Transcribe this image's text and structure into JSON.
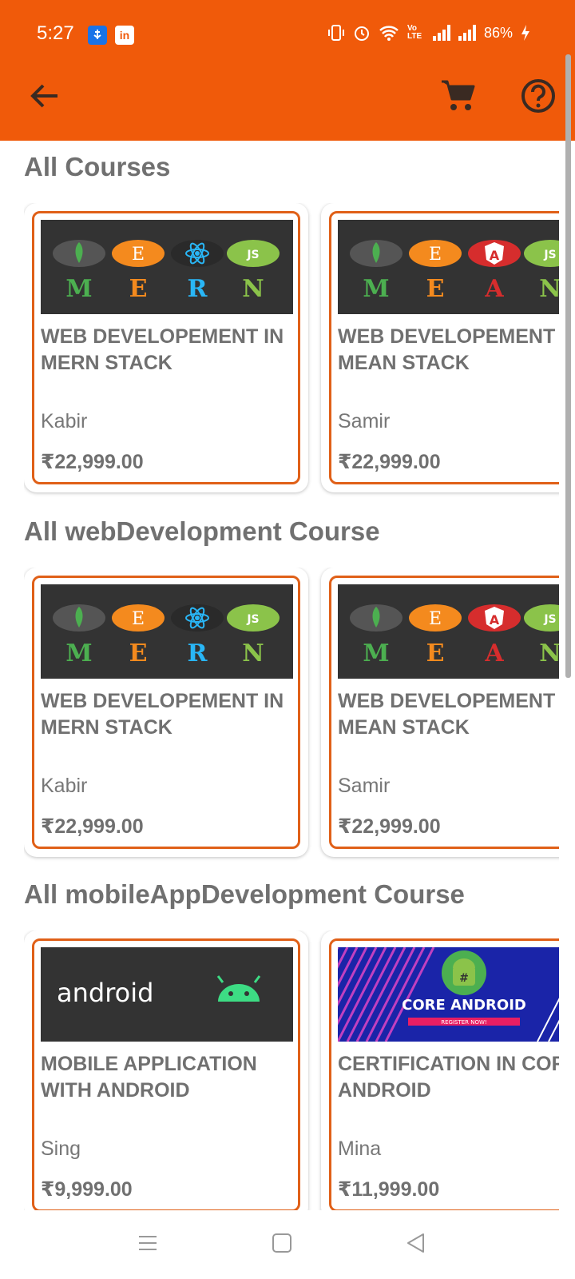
{
  "status_bar": {
    "time": "5:27",
    "battery": "86%",
    "icons": [
      "usb-icon",
      "linkedin-icon",
      "vibrate-icon",
      "alarm-icon",
      "wifi-icon",
      "volte-icon",
      "signal-icon",
      "signal-icon",
      "battery-charging-icon"
    ],
    "volte_label": "Vo LTE"
  },
  "toolbar": {
    "back_icon": "arrow-back-icon",
    "cart_icon": "cart-icon",
    "help_icon": "help-icon"
  },
  "sections": [
    {
      "title": "All Courses",
      "courses": [
        {
          "title": "WEB DEVELOPEMENT IN\nMERN STACK",
          "author": "Kabir",
          "price": "₹22,999.00",
          "thumb": "mern",
          "letters": [
            "M",
            "E",
            "R",
            "N"
          ]
        },
        {
          "title": "WEB DEVELOPEMENT IN\nMEAN STACK",
          "author": "Samir",
          "price": "₹22,999.00",
          "thumb": "mean",
          "letters": [
            "M",
            "E",
            "A",
            "N"
          ]
        }
      ]
    },
    {
      "title": "All webDevelopment Course",
      "courses": [
        {
          "title": "WEB DEVELOPEMENT IN\nMERN STACK",
          "author": "Kabir",
          "price": "₹22,999.00",
          "thumb": "mern",
          "letters": [
            "M",
            "E",
            "R",
            "N"
          ]
        },
        {
          "title": "WEB DEVELOPEMENT IN\nMEAN STACK",
          "author": "Samir",
          "price": "₹22,999.00",
          "thumb": "mean",
          "letters": [
            "M",
            "E",
            "A",
            "N"
          ]
        }
      ]
    },
    {
      "title": "All mobileAppDevelopment Course",
      "courses": [
        {
          "title": "MOBILE APPLICATION\nWITH ANDROID",
          "author": "Sing",
          "price": "₹9,999.00",
          "thumb": "android",
          "logo_text": "android"
        },
        {
          "title": "CERTIFICATION IN CORE\nANDROID",
          "author": "Mina",
          "price": "₹11,999.00",
          "thumb": "core-android",
          "banner_text": "CORE ANDROID",
          "banner_sub": "REGISTER NOW!"
        }
      ]
    }
  ],
  "nav": {
    "icons": [
      "menu-icon",
      "home-square-icon",
      "back-triangle-icon"
    ]
  },
  "colors": {
    "primary": "#f05a0a",
    "card_border": "#e06018",
    "text": "#707070"
  }
}
